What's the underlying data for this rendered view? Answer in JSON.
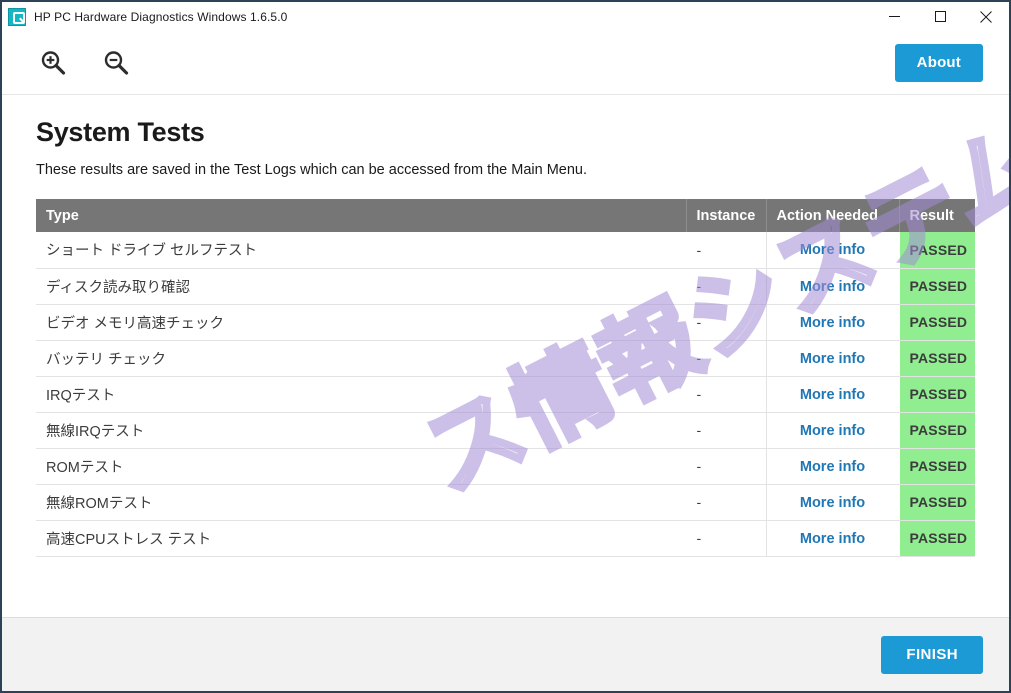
{
  "window": {
    "title": "HP PC Hardware Diagnostics Windows 1.6.5.0",
    "app_icon": "hp-diagnostics-icon",
    "controls": {
      "minimize": "minimize-icon",
      "maximize": "maximize-icon",
      "close": "close-icon"
    },
    "border_color": "#2b4257"
  },
  "toolbar": {
    "zoom_in_icon": "zoom-in-icon",
    "zoom_out_icon": "zoom-out-icon",
    "about_label": "About",
    "accent_color": "#1c9ad6"
  },
  "page": {
    "title": "System Tests",
    "subtitle": "These results are saved in the Test Logs which can be accessed from the Main Menu."
  },
  "table": {
    "header_background": "#767676",
    "columns": [
      "Type",
      "Instance",
      "Action Needed",
      "Result"
    ],
    "rows": [
      {
        "type": "ショート ドライブ セルフテスト",
        "instance": "-",
        "action": "More info",
        "result": "PASSED"
      },
      {
        "type": "ディスク読み取り確認",
        "instance": "-",
        "action": "More info",
        "result": "PASSED"
      },
      {
        "type": "ビデオ メモリ高速チェック",
        "instance": "-",
        "action": "More info",
        "result": "PASSED"
      },
      {
        "type": "バッテリ チェック",
        "instance": "-",
        "action": "More info",
        "result": "PASSED"
      },
      {
        "type": "IRQテスト",
        "instance": "-",
        "action": "More info",
        "result": "PASSED"
      },
      {
        "type": "無線IRQテスト",
        "instance": "-",
        "action": "More info",
        "result": "PASSED"
      },
      {
        "type": "ROMテスト",
        "instance": "-",
        "action": "More info",
        "result": "PASSED"
      },
      {
        "type": "無線ROMテスト",
        "instance": "-",
        "action": "More info",
        "result": "PASSED"
      },
      {
        "type": "高速CPUストレス テスト",
        "instance": "-",
        "action": "More info",
        "result": "PASSED"
      }
    ],
    "result_passed_color": "#90ee90",
    "link_color": "#1f77b4"
  },
  "footer": {
    "finish_label": "FINISH"
  },
  "watermark": {
    "text": "ス情報システム"
  }
}
